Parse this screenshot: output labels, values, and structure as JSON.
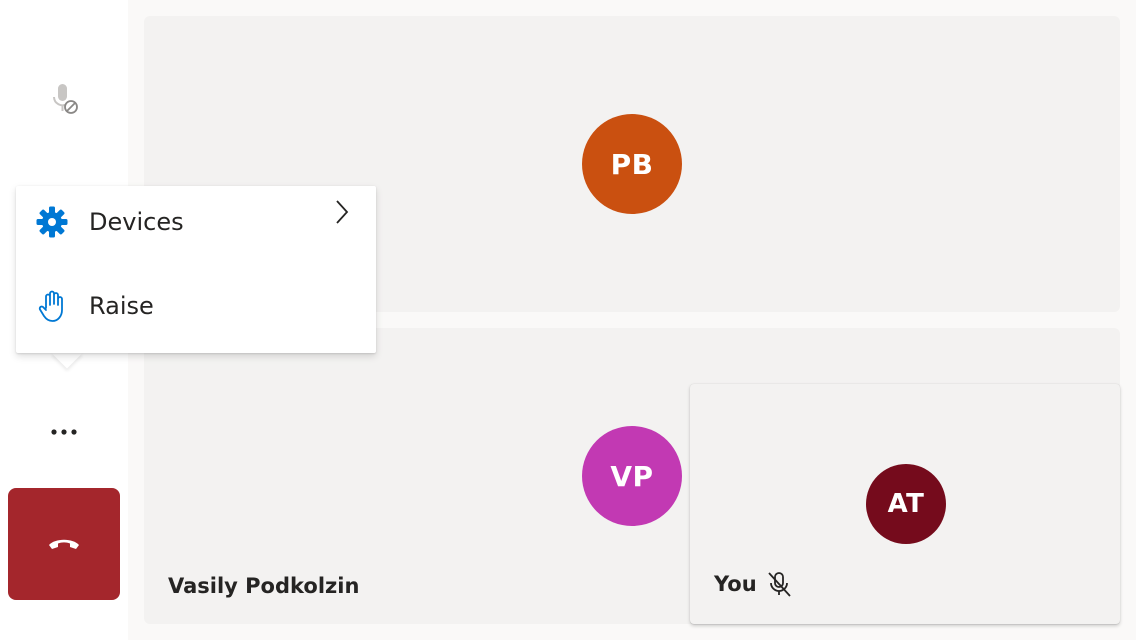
{
  "sidebar": {
    "mic_icon": "mic-off-icon",
    "more_icon": "more-horizontal-icon",
    "hangup_icon": "hang-up-icon",
    "hangup_color": "#a4262c"
  },
  "context_menu": {
    "items": [
      {
        "label": "Devices",
        "icon": "gear-icon",
        "has_submenu": true
      },
      {
        "label": "Raise",
        "icon": "raise-hand-icon",
        "has_submenu": false
      }
    ],
    "icon_color": "#0078d4"
  },
  "participants": [
    {
      "initials": "PB",
      "name": "",
      "avatar_color": "#ca5010"
    },
    {
      "initials": "VP",
      "name": "Vasily Podkolzin",
      "avatar_color": "#c239b3"
    }
  ],
  "self_view": {
    "initials": "AT",
    "label": "You",
    "avatar_color": "#750b1c",
    "muted_icon": "mic-off-icon"
  }
}
